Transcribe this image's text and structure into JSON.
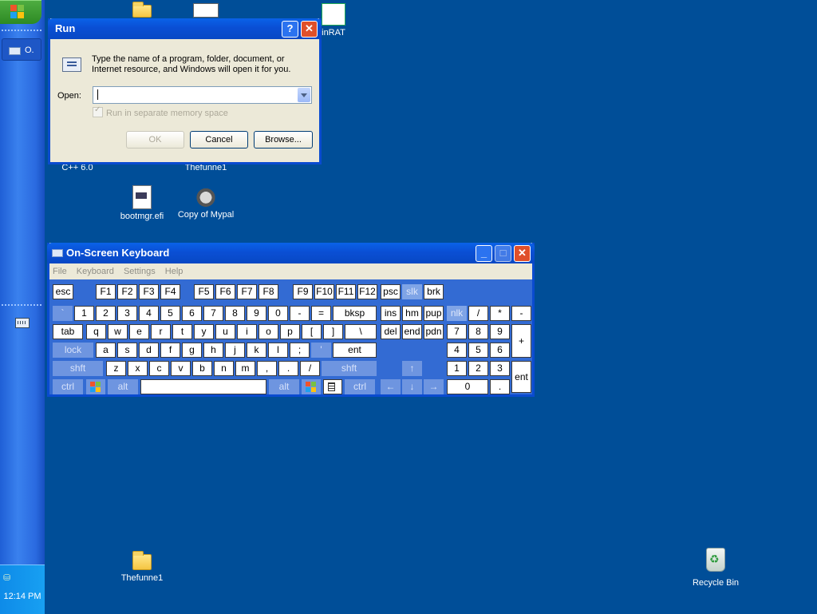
{
  "desktop": {
    "icons": [
      {
        "label": ""
      },
      {
        "label": ""
      },
      {
        "label": "inRAT"
      },
      {
        "label": "C++ 6.0"
      },
      {
        "label": "Thefunne1"
      },
      {
        "label": "bootmgr.efi"
      },
      {
        "label": "Copy of Mypal"
      },
      {
        "label": "Thefunne1"
      },
      {
        "label": "Recycle Bin"
      }
    ]
  },
  "taskbar": {
    "task_label": "O.",
    "clock": "12:14 PM"
  },
  "run_dialog": {
    "title": "Run",
    "help_glyph": "?",
    "close_glyph": "✕",
    "description": "Type the name of a program, folder, document, or Internet resource, and Windows will open it for you.",
    "open_label": "Open:",
    "open_value": "",
    "checkbox_label": "Run in separate memory space",
    "ok_label": "OK",
    "cancel_label": "Cancel",
    "browse_label": "Browse..."
  },
  "osk": {
    "title": "On-Screen Keyboard",
    "menu": [
      "File",
      "Keyboard",
      "Settings",
      "Help"
    ],
    "keys": {
      "esc": "esc",
      "f1": "F1",
      "f2": "F2",
      "f3": "F3",
      "f4": "F4",
      "f5": "F5",
      "f6": "F6",
      "f7": "F7",
      "f8": "F8",
      "f9": "F9",
      "f10": "F10",
      "f11": "F11",
      "f12": "F12",
      "psc": "psc",
      "slk": "slk",
      "brk": "brk",
      "backtick": "`",
      "n1": "1",
      "n2": "2",
      "n3": "3",
      "n4": "4",
      "n5": "5",
      "n6": "6",
      "n7": "7",
      "n8": "8",
      "n9": "9",
      "n0": "0",
      "minus": "-",
      "equals": "=",
      "bksp": "bksp",
      "ins": "ins",
      "hm": "hm",
      "pup": "pup",
      "nlk": "nlk",
      "kp_div": "/",
      "kp_mul": "*",
      "kp_sub": "-",
      "tab": "tab",
      "q": "q",
      "w": "w",
      "e": "e",
      "r": "r",
      "t": "t",
      "y": "y",
      "u": "u",
      "i": "i",
      "o": "o",
      "p": "p",
      "lbr": "[",
      "rbr": "]",
      "bslash": "\\",
      "del": "del",
      "end": "end",
      "pdn": "pdn",
      "kp7": "7",
      "kp8": "8",
      "kp9": "9",
      "kp_add": "+",
      "lock": "lock",
      "a": "a",
      "s": "s",
      "d": "d",
      "f": "f",
      "g": "g",
      "h": "h",
      "j": "j",
      "k": "k",
      "l": "l",
      "semi": ";",
      "quote": "'",
      "ent": "ent",
      "kp4": "4",
      "kp5": "5",
      "kp6": "6",
      "lshft": "shft",
      "z": "z",
      "x": "x",
      "c": "c",
      "v": "v",
      "b": "b",
      "n": "n",
      "m": "m",
      "comma": ",",
      "period": ".",
      "slash": "/",
      "rshft": "shft",
      "up": "↑",
      "kp1": "1",
      "kp2": "2",
      "kp3": "3",
      "kp_ent": "ent",
      "lctrl": "ctrl",
      "lalt": "alt",
      "ralt": "alt",
      "rctrl": "ctrl",
      "left": "←",
      "down": "↓",
      "right": "→",
      "kp0": "0",
      "kp_dot": "."
    }
  }
}
